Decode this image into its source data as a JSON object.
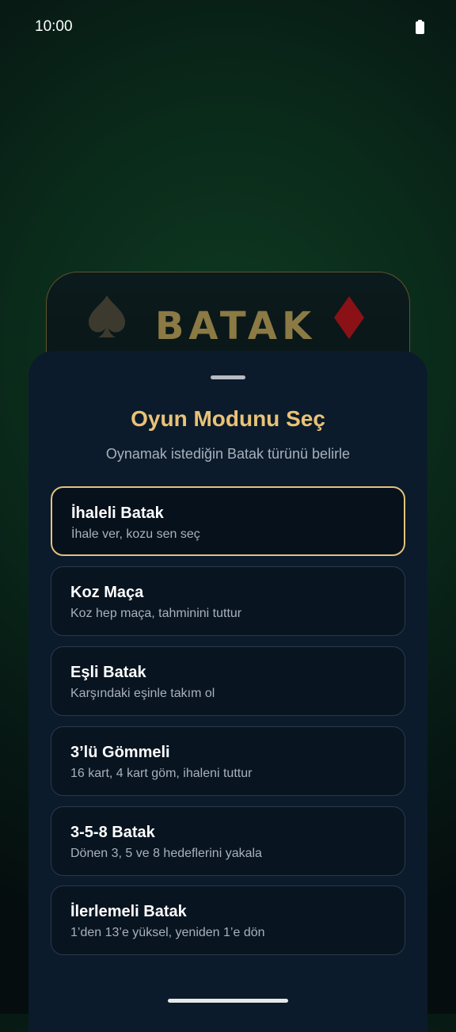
{
  "status_bar": {
    "time": "10:00"
  },
  "logo": {
    "text": "BATAK",
    "left_icon": "spade-icon",
    "right_icon": "diamond-icon"
  },
  "sheet": {
    "title": "Oyun Modunu Seç",
    "subtitle": "Oynamak istediğin Batak türünü belirle",
    "modes": [
      {
        "title": "İhaleli Batak",
        "desc": "İhale ver, kozu sen seç",
        "selected": true
      },
      {
        "title": "Koz Maça",
        "desc": "Koz hep maça, tahminini tuttur",
        "selected": false
      },
      {
        "title": "Eşli Batak",
        "desc": "Karşındaki eşinle takım ol",
        "selected": false
      },
      {
        "title": "3’lü Gömmeli",
        "desc": "16 kart, 4 kart göm, ihaleni tuttur",
        "selected": false
      },
      {
        "title": "3-5-8 Batak",
        "desc": "Dönen 3, 5 ve 8 hedeflerini yakala",
        "selected": false
      },
      {
        "title": "İlerlemeli Batak",
        "desc": "1’den 13’e yüksel, yeniden 1’e dön",
        "selected": false
      }
    ]
  },
  "colors": {
    "accent_gold": "#e9c277",
    "sheet_bg": "#0c1b2b",
    "diamond_red": "#8a1116"
  }
}
